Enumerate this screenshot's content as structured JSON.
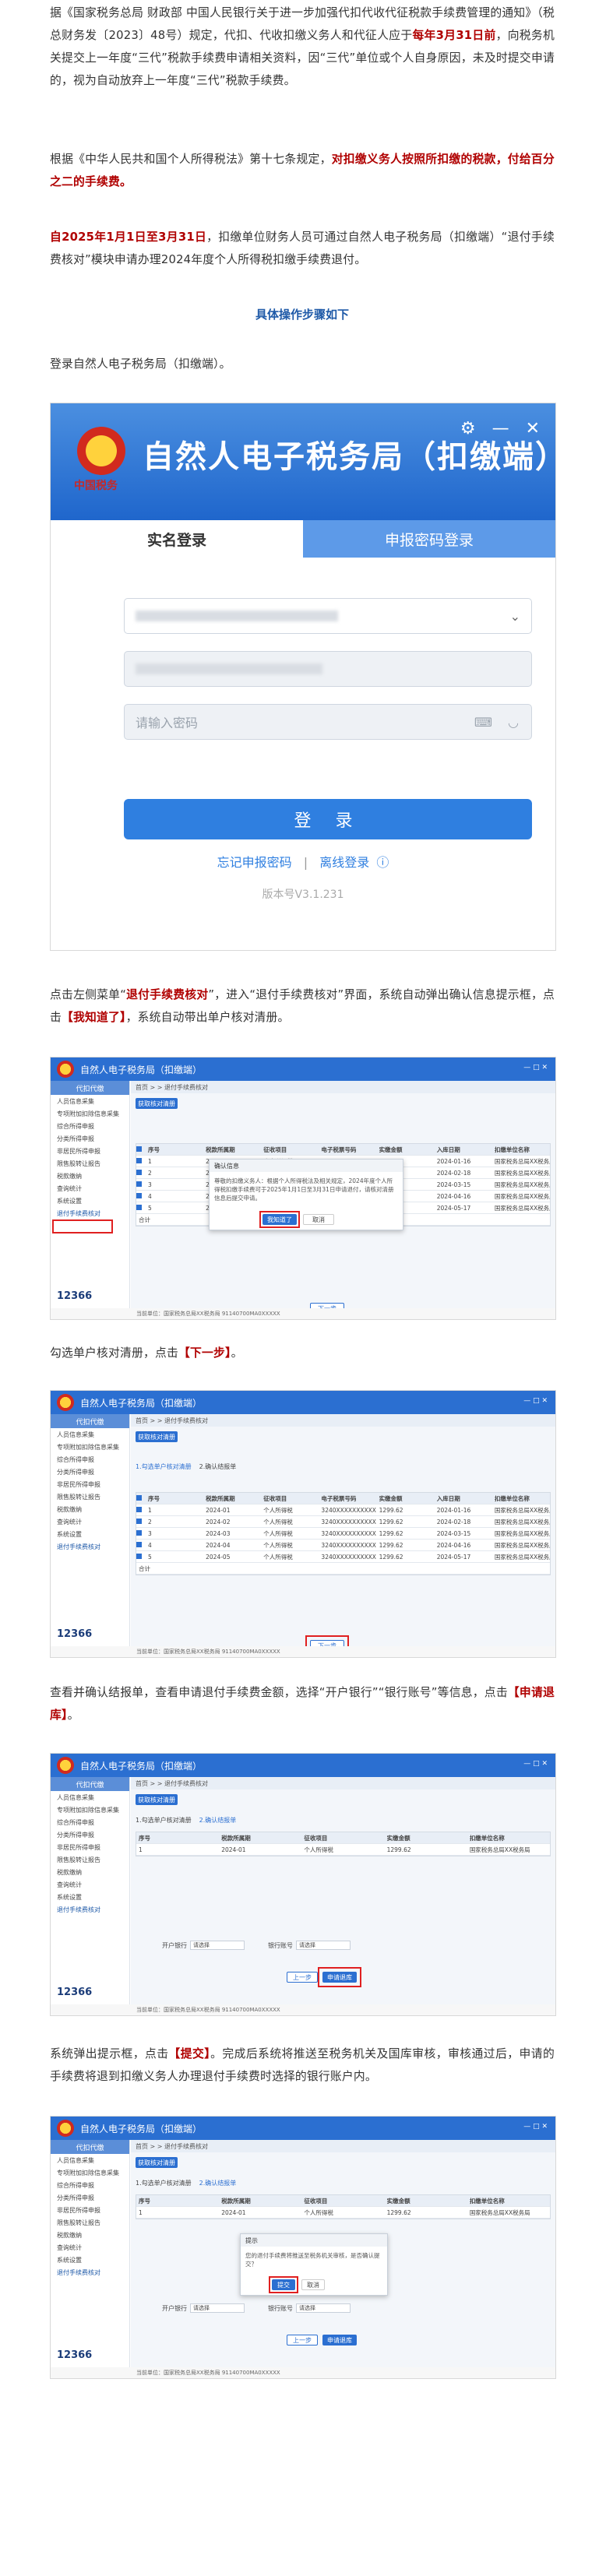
{
  "p1": {
    "a": "据《国家税务总局 财政部 中国人民银行关于进一步加强代扣代收代征税款手续费管理的通知》（税总财务发〔2023〕48号）规定，代扣、代收扣缴义务人和代征人应于",
    "a_red": "每年3月31日前",
    "b": "，向税务机关提交上一年度“三代”税款手续费申请相关资料，因“三代”单位或个人自身原因，未及时提交申请的，视为自动放弃上一年度“三代”税款手续费。"
  },
  "p2": {
    "a": "根据《中华人民共和国个人所得税法》第十七条规定，",
    "a_red": "对扣缴义务人按照所扣缴的税款，付给百分之二的手续费。"
  },
  "p3": {
    "a_red": "自2025年1月1日至3月31日",
    "b": "，扣缴单位财务人员可通过自然人电子税务局（扣缴端）“退付手续费核对”模块申请办理2024年度个人所得税扣缴手续费退付。"
  },
  "steps_title": "具体操作步骤如下",
  "p4": "登录自然人电子税务局（扣缴端）。",
  "login": {
    "emblem_text": "中国税务",
    "title": "自然人电子税务局（扣缴端）",
    "tab_real": "实名登录",
    "tab_pwd": "申报密码登录",
    "pwd_placeholder": "请输入密码",
    "login_button": "登 录",
    "forgot": "忘记申报密码",
    "sep": "|",
    "offline": "离线登录",
    "version": "版本号V3.1.231"
  },
  "p5": {
    "a": "点击左侧菜单“",
    "a_red": "退付手续费核对",
    "b": "”，进入“退付手续费核对”界面，系统自动弹出确认信息提示框，点击",
    "b_red": "【我知道了】",
    "c": "，系统自动带出单户核对清册。"
  },
  "p6": {
    "a": "勾选单户核对清册，点击",
    "a_red": "【下一步】",
    "b": "。"
  },
  "p7": {
    "a": "查看并确认结报单，查看申请退付手续费金额，选择“开户银行”“银行账号”等信息，点击",
    "a_red": "【申请退库】",
    "b": "。"
  },
  "p8": {
    "a": "系统弹出提示框，点击",
    "a_red": "【提交】",
    "b": "。完成后系统将推送至税务机关及国库审核，审核通过后，申请的手续费将退到扣缴义务人办理退付手续费时选择的银行账户内。"
  },
  "app": {
    "title": "自然人电子税务局（扣缴端）",
    "side_header": "代扣代缴",
    "side_items": [
      "人员信息采集",
      "专项附加扣除信息采集",
      "综合所得申报",
      "分类所得申报",
      "非居民所得申报",
      "限售股转让报告",
      "税款缴纳",
      "查询统计",
      "系统设置",
      "退付手续费核对"
    ],
    "crumb": "首页 > > 退付手续费核对",
    "btn_query": "获取核对清册",
    "tab1": "1.勾选单户核对清册",
    "tab2": "2.确认结报单",
    "headers": [
      "序号",
      "税款所属期",
      "征收项目",
      "电子税票号码",
      "实缴金额",
      "入库日期",
      "扣缴单位名称"
    ],
    "rows": [
      [
        "1",
        "2024-01",
        "个人所得税",
        "3240XXXXXXXXXX",
        "1299.62",
        "2024-01-16",
        "国家税务总局XX税务局"
      ],
      [
        "2",
        "2024-02",
        "个人所得税",
        "3240XXXXXXXXXX",
        "1299.62",
        "2024-02-18",
        "国家税务总局XX税务局"
      ],
      [
        "3",
        "2024-03",
        "个人所得税",
        "3240XXXXXXXXXX",
        "1299.62",
        "2024-03-15",
        "国家税务总局XX税务局"
      ],
      [
        "4",
        "2024-04",
        "个人所得税",
        "3240XXXXXXXXXX",
        "1299.62",
        "2024-04-16",
        "国家税务总局XX税务局"
      ],
      [
        "5",
        "2024-05",
        "个人所得税",
        "3240XXXXXXXXXX",
        "1299.62",
        "2024-05-17",
        "国家税务总局XX税务局"
      ]
    ],
    "total": "合计",
    "next": "下一步",
    "prev": "上一步",
    "apply": "申请退库",
    "dialog1_title": "确认信息",
    "dialog1_text": "尊敬的扣缴义务人：根据个人所得税法及相关规定，2024年度个人所得税扣缴手续费可于2025年1月1日至3月31日申请退付，请核对清册信息后提交申请。",
    "dialog1_ok": "我知道了",
    "dialog1_cancel": "取消",
    "bank_label": "开户银行",
    "account_label": "银行账号",
    "bank_select": "请选择",
    "dialog2_title": "提示",
    "dialog2_text": "您的退付手续费将推送至税务机关审核，是否确认提交？",
    "dialog2_ok": "提交",
    "dialog2_cancel": "取消",
    "footer": "当前单位：国家税务总局XX税务局 91140700MA0XXXXX",
    "hotline": "12366"
  }
}
